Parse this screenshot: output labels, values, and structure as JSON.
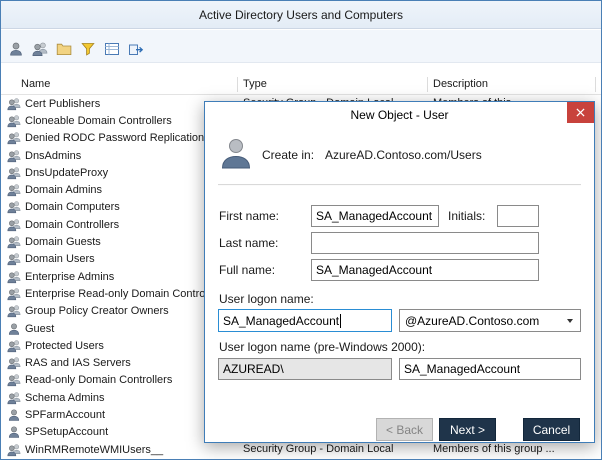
{
  "colors": {
    "window_border": "#4a7fb5",
    "dialog_border": "#3f7db8",
    "close_button": "#c8423c",
    "primary_button": "#1f344a",
    "focus_border": "#2a8dd4"
  },
  "window": {
    "title": "Active Directory Users and Computers"
  },
  "toolbar": {
    "buttons": [
      {
        "id": "new-user",
        "icon": "sym-user"
      },
      {
        "id": "new-group",
        "icon": "sym-group"
      },
      {
        "id": "new-ou",
        "icon": "sym-folder"
      },
      {
        "id": "filter",
        "icon": "sym-funnel"
      },
      {
        "id": "list-view",
        "icon": "sym-list"
      },
      {
        "id": "export-list",
        "icon": "sym-export"
      }
    ]
  },
  "list": {
    "columns": [
      "Name",
      "Type",
      "Description"
    ],
    "items": [
      {
        "name": "Cert Publishers",
        "icon": "group",
        "type": "Security Group - Domain Local",
        "description": "Members of this..."
      },
      {
        "name": "Cloneable Domain Controllers",
        "icon": "group"
      },
      {
        "name": "Denied RODC Password Replication",
        "icon": "group"
      },
      {
        "name": "DnsAdmins",
        "icon": "group"
      },
      {
        "name": "DnsUpdateProxy",
        "icon": "group"
      },
      {
        "name": "Domain Admins",
        "icon": "group"
      },
      {
        "name": "Domain Computers",
        "icon": "group"
      },
      {
        "name": "Domain Controllers",
        "icon": "group"
      },
      {
        "name": "Domain Guests",
        "icon": "group"
      },
      {
        "name": "Domain Users",
        "icon": "group"
      },
      {
        "name": "Enterprise Admins",
        "icon": "group"
      },
      {
        "name": "Enterprise Read-only Domain Controllers",
        "icon": "group"
      },
      {
        "name": "Group Policy Creator Owners",
        "icon": "group"
      },
      {
        "name": "Guest",
        "icon": "user"
      },
      {
        "name": "Protected Users",
        "icon": "group"
      },
      {
        "name": "RAS and IAS Servers",
        "icon": "group"
      },
      {
        "name": "Read-only Domain Controllers",
        "icon": "group"
      },
      {
        "name": "Schema Admins",
        "icon": "group"
      },
      {
        "name": "SPFarmAccount",
        "icon": "user"
      },
      {
        "name": "SPSetupAccount",
        "icon": "user"
      },
      {
        "name": "WinRMRemoteWMIUsers__",
        "icon": "group",
        "type": "Security Group - Domain Local",
        "description": "Members of this group ..."
      }
    ]
  },
  "dialog": {
    "title": "New Object - User",
    "create_in": {
      "label": "Create in:",
      "value": "AzureAD.Contoso.com/Users"
    },
    "first_name": {
      "label": "First name:",
      "value": "SA_ManagedAccount"
    },
    "initials": {
      "label": "Initials:",
      "value": ""
    },
    "last_name": {
      "label": "Last name:",
      "value": ""
    },
    "full_name": {
      "label": "Full name:",
      "value": "SA_ManagedAccount"
    },
    "logon": {
      "label": "User logon name:",
      "value": "SA_ManagedAccount",
      "domain": "@AzureAD.Contoso.com"
    },
    "pre2000": {
      "label": "User logon name (pre-Windows 2000):",
      "prefix": "AZUREAD\\",
      "value": "SA_ManagedAccount"
    },
    "buttons": {
      "back": "< Back",
      "next": "Next >",
      "cancel": "Cancel"
    }
  }
}
